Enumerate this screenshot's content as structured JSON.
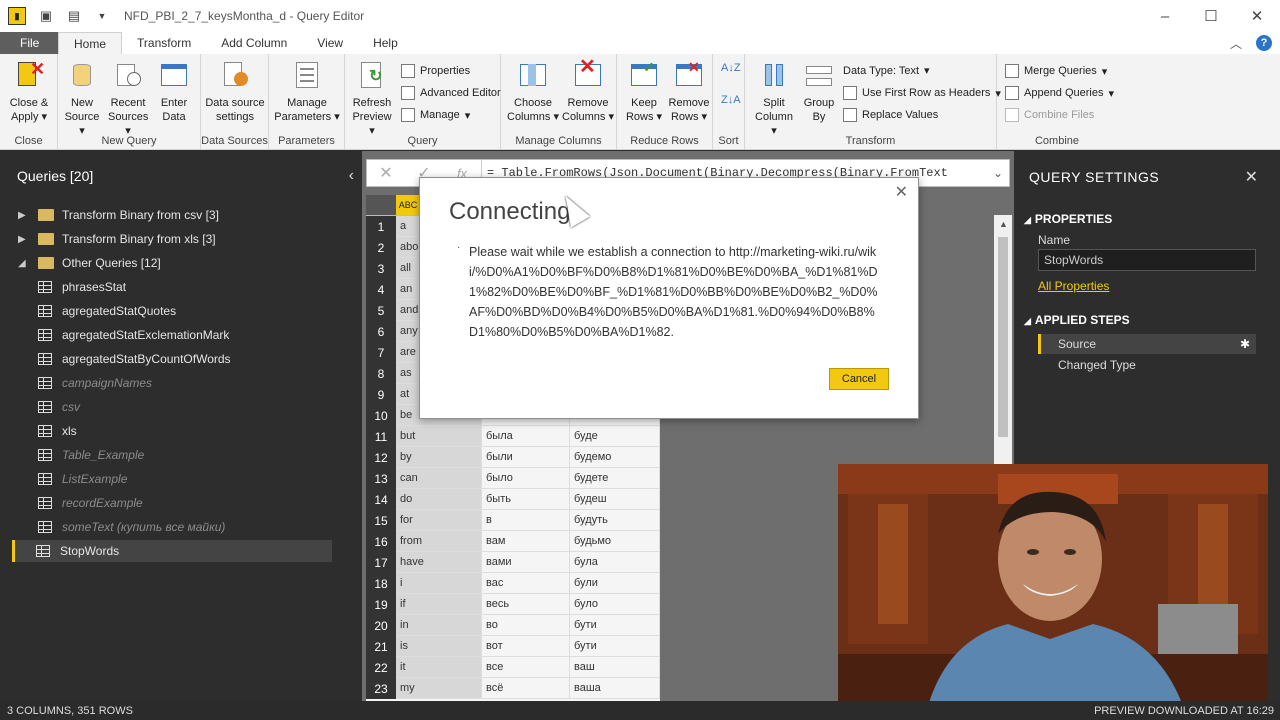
{
  "window": {
    "title": "NFD_PBI_2_7_keysMontha_d - Query Editor",
    "qa_save_icon": "save-icon",
    "qa_new_icon": "new-file-icon",
    "controls": {
      "minimize": "–",
      "maximize": "☐",
      "close": "✕"
    }
  },
  "ribbon_tabs": [
    "File",
    "Home",
    "Transform",
    "Add Column",
    "View",
    "Help"
  ],
  "ribbon": {
    "close_apply": "Close & Apply",
    "close_group": "Close",
    "new_source": "New Source",
    "recent_sources": "Recent Sources",
    "enter_data": "Enter Data",
    "new_query_group": "New Query",
    "data_source_settings": "Data source settings",
    "data_sources_group": "Data Sources",
    "manage_parameters": "Manage Parameters",
    "parameters_group": "Parameters",
    "refresh_preview": "Refresh Preview",
    "properties": "Properties",
    "advanced_editor": "Advanced Editor",
    "manage": "Manage",
    "query_group": "Query",
    "choose_columns": "Choose Columns",
    "remove_columns": "Remove Columns",
    "manage_columns_group": "Manage Columns",
    "keep_rows": "Keep Rows",
    "remove_rows": "Remove Rows",
    "reduce_rows_group": "Reduce Rows",
    "sort_group": "Sort",
    "split_column": "Split Column",
    "group_by": "Group By",
    "data_type": "Data Type: Text",
    "use_first_row": "Use First Row as Headers",
    "replace_values": "Replace Values",
    "transform_group": "Transform",
    "merge_queries": "Merge Queries",
    "append_queries": "Append Queries",
    "combine_files": "Combine Files",
    "combine_group": "Combine"
  },
  "queries": {
    "header": "Queries [20]",
    "items": [
      {
        "label": "Transform Binary from csv [3]",
        "type": "folder",
        "expanded": false
      },
      {
        "label": "Transform Binary from xls [3]",
        "type": "folder",
        "expanded": false
      },
      {
        "label": "Other Queries [12]",
        "type": "folder",
        "expanded": true
      },
      {
        "label": "phrasesStat",
        "type": "table"
      },
      {
        "label": "agregatedStatQuotes",
        "type": "table"
      },
      {
        "label": "agregatedStatExclemationMark",
        "type": "table"
      },
      {
        "label": "agregatedStatByCountOfWords",
        "type": "table"
      },
      {
        "label": "campaignNames",
        "type": "table",
        "faded": true
      },
      {
        "label": "csv",
        "type": "table",
        "faded": true
      },
      {
        "label": "xls",
        "type": "table"
      },
      {
        "label": "Table_Example",
        "type": "table",
        "faded": true
      },
      {
        "label": "ListExample",
        "type": "list",
        "faded": true
      },
      {
        "label": "recordExample",
        "type": "record",
        "faded": true
      },
      {
        "label": "someText (купить все майки)",
        "type": "text",
        "faded": true
      },
      {
        "label": "StopWords",
        "type": "table",
        "selected": true
      }
    ]
  },
  "formula": {
    "cancel": "✕",
    "commit": "✓",
    "fx": "fx",
    "text": "= Table.FromRows(Json.Document(Binary.Decompress(Binary.FromText"
  },
  "grid": {
    "col1_header": "ABC",
    "rows": [
      {
        "n": "1",
        "a": "a",
        "b": "",
        "c": ""
      },
      {
        "n": "2",
        "a": "about",
        "b": "",
        "c": ""
      },
      {
        "n": "3",
        "a": "all",
        "b": "",
        "c": ""
      },
      {
        "n": "4",
        "a": "an",
        "b": "",
        "c": ""
      },
      {
        "n": "5",
        "a": "and",
        "b": "",
        "c": ""
      },
      {
        "n": "6",
        "a": "any",
        "b": "",
        "c": ""
      },
      {
        "n": "7",
        "a": "are",
        "b": "",
        "c": ""
      },
      {
        "n": "8",
        "a": "as",
        "b": "",
        "c": ""
      },
      {
        "n": "9",
        "a": "at",
        "b": "",
        "c": ""
      },
      {
        "n": "10",
        "a": "be",
        "b": "",
        "c": ""
      },
      {
        "n": "11",
        "a": "but",
        "b": "была",
        "c": "буде"
      },
      {
        "n": "12",
        "a": "by",
        "b": "были",
        "c": "будемо"
      },
      {
        "n": "13",
        "a": "can",
        "b": "было",
        "c": "будете"
      },
      {
        "n": "14",
        "a": "do",
        "b": "быть",
        "c": "будеш"
      },
      {
        "n": "15",
        "a": "for",
        "b": "в",
        "c": "будуть"
      },
      {
        "n": "16",
        "a": "from",
        "b": "вам",
        "c": "будьмо"
      },
      {
        "n": "17",
        "a": "have",
        "b": "вами",
        "c": "була"
      },
      {
        "n": "18",
        "a": "i",
        "b": "вас",
        "c": "були"
      },
      {
        "n": "19",
        "a": "if",
        "b": "весь",
        "c": "було"
      },
      {
        "n": "20",
        "a": "in",
        "b": "во",
        "c": "бути"
      },
      {
        "n": "21",
        "a": "is",
        "b": "вот",
        "c": "бути"
      },
      {
        "n": "22",
        "a": "it",
        "b": "все",
        "c": "ваш"
      },
      {
        "n": "23",
        "a": "my",
        "b": "всё",
        "c": "ваша"
      }
    ]
  },
  "dialog": {
    "title": "Connecting",
    "message": "Please wait while we establish a connection to http://marketing-wiki.ru/wiki/%D0%A1%D0%BF%D0%B8%D1%81%D0%BE%D0%BA_%D1%81%D1%82%D0%BE%D0%BF_%D1%81%D0%BB%D0%BE%D0%B2_%D0%AF%D0%BD%D0%B4%D0%B5%D0%BA%D1%81.%D0%94%D0%B8%D1%80%D0%B5%D0%BA%D1%82.",
    "cancel": "Cancel",
    "close": "✕"
  },
  "settings": {
    "title": "QUERY SETTINGS",
    "properties": "PROPERTIES",
    "name_label": "Name",
    "name_value": "StopWords",
    "all_properties": "All Properties",
    "applied_steps": "APPLIED STEPS",
    "steps": [
      "Source",
      "Changed Type"
    ]
  },
  "status": {
    "left": "3 COLUMNS, 351 ROWS",
    "right": "PREVIEW DOWNLOADED AT 16:29"
  },
  "colors": {
    "accent": "#f2c811",
    "pane_bg": "#2d2d2d",
    "ribbon_bg": "#f3f3f3"
  }
}
